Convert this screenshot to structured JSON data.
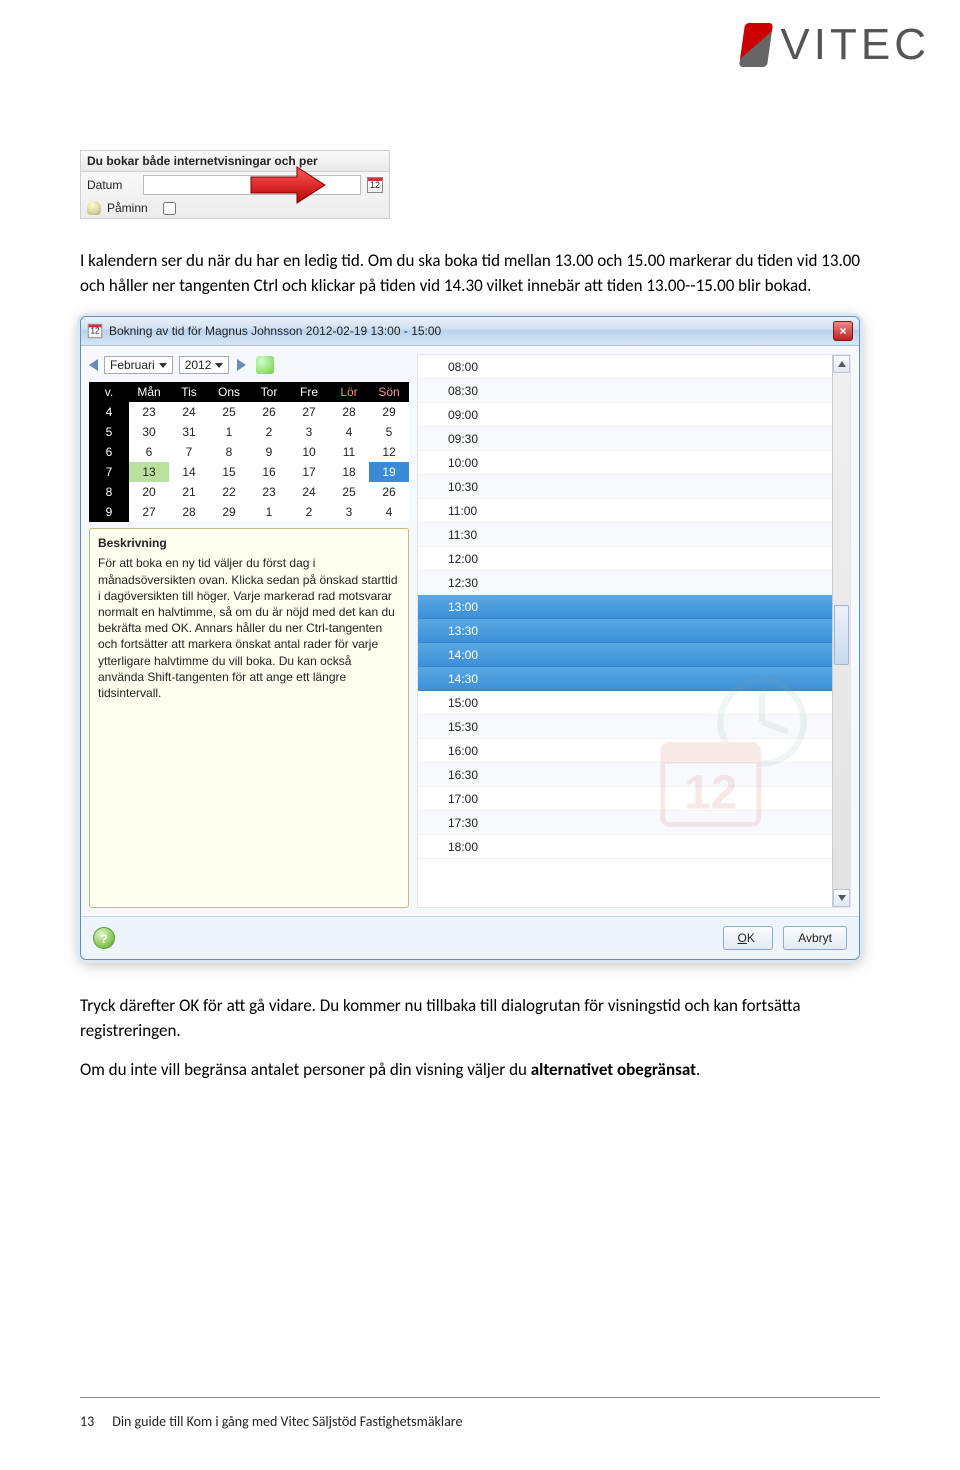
{
  "brand": {
    "name": "VITEC"
  },
  "snippet": {
    "title": "Du bokar både internetvisningar och per",
    "datum_label": "Datum",
    "paminn_label": "Påminn",
    "cal_num": "12"
  },
  "paragraphs": {
    "p1": "I kalendern ser du när du har en ledig tid. Om du ska boka tid mellan 13.00 och 15.00 markerar du tiden vid 13.00 och håller ner tangenten Ctrl och klickar på tiden vid 14.30 vilket innebär att tiden 13.00--15.00 blir bokad.",
    "p2": "Tryck därefter OK för att gå vidare. Du kommer nu tillbaka till dialogrutan för visningstid och kan fortsätta registreringen.",
    "p3_a": "Om du inte vill begränsa antalet personer på din visning väljer du ",
    "p3_b": "alternativet obegränsat",
    "p3_c": "."
  },
  "dialog": {
    "title": "Bokning av tid för Magnus Johnsson 2012-02-19 13:00 - 15:00",
    "month": "Februari",
    "year": "2012",
    "weekday_header": [
      "v.",
      "Mån",
      "Tis",
      "Ons",
      "Tor",
      "Fre",
      "Lör",
      "Sön"
    ],
    "weeks": [
      {
        "wk": "4",
        "d": [
          "23",
          "24",
          "25",
          "26",
          "27",
          "28",
          "29"
        ],
        "dim": [
          0,
          1,
          2,
          3,
          4
        ],
        "sat": 5,
        "sun": 6
      },
      {
        "wk": "5",
        "d": [
          "30",
          "31",
          "1",
          "2",
          "3",
          "4",
          "5"
        ],
        "dim": [
          0,
          1
        ],
        "sat": 5,
        "sun": 6
      },
      {
        "wk": "6",
        "d": [
          "6",
          "7",
          "8",
          "9",
          "10",
          "11",
          "12"
        ],
        "sat": 5,
        "sun": 6
      },
      {
        "wk": "7",
        "d": [
          "13",
          "14",
          "15",
          "16",
          "17",
          "18",
          "19"
        ],
        "today": 0,
        "sel": 6,
        "sat": 5,
        "sun": 6
      },
      {
        "wk": "8",
        "d": [
          "20",
          "21",
          "22",
          "23",
          "24",
          "25",
          "26"
        ],
        "sat": 5,
        "sun": 6
      },
      {
        "wk": "9",
        "d": [
          "27",
          "28",
          "29",
          "1",
          "2",
          "3",
          "4"
        ],
        "dim": [
          3,
          4,
          5,
          6
        ],
        "sat": 5,
        "sun": 6
      }
    ],
    "desc": {
      "title": "Beskrivning",
      "text": "För att boka en ny tid väljer du först dag i månadsöversikten ovan. Klicka sedan på önskad starttid i dagöversikten till höger. Varje markerad rad motsvarar normalt en halvtimme, så om du är nöjd med det kan du bekräfta med OK. Annars håller du ner Ctrl-tangenten och fortsätter att markera önskat antal rader för varje ytterligare halvtimme du vill boka. Du kan också använda Shift-tangenten för att ange ett längre tidsintervall."
    },
    "times": [
      "08:00",
      "08:30",
      "09:00",
      "09:30",
      "10:00",
      "10:30",
      "11:00",
      "11:30",
      "12:00",
      "12:30",
      "13:00",
      "13:30",
      "14:00",
      "14:30",
      "15:00",
      "15:30",
      "16:00",
      "16:30",
      "17:00",
      "17:30",
      "18:00"
    ],
    "selected_times": [
      "13:00",
      "13:30",
      "14:00",
      "14:30"
    ],
    "ok_label": "OK",
    "cancel_label": "Avbryt",
    "close_label": "×",
    "help_label": "?"
  },
  "footer": {
    "page": "13",
    "title": "Din guide till Kom i gång med Vitec Säljstöd Fastighetsmäklare"
  }
}
